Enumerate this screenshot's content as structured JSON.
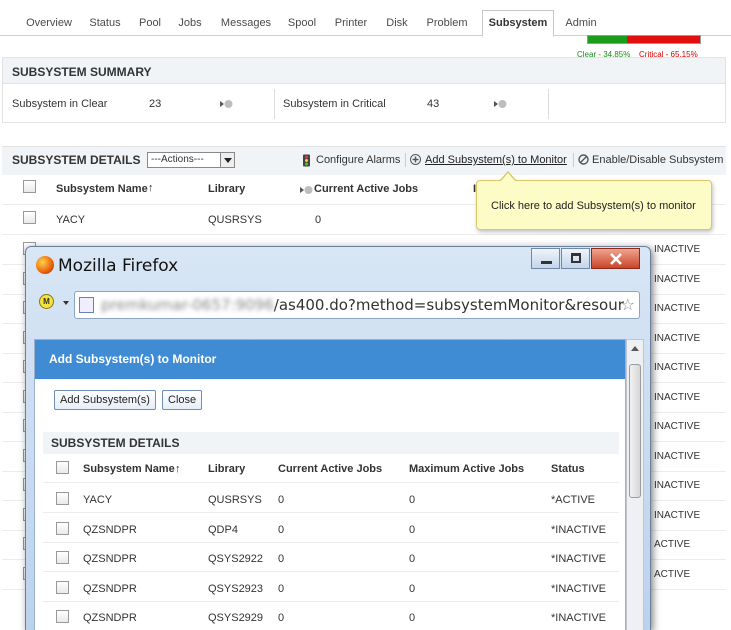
{
  "tabs": [
    "Overview",
    "Status",
    "Pool",
    "Jobs",
    "Messages",
    "Spool",
    "Printer",
    "Disk",
    "Problem",
    "Subsystem",
    "Admin"
  ],
  "active_tab": "Subsystem",
  "summary": {
    "title": "SUBSYSTEM SUMMARY",
    "clear_label": "Subsystem in Clear",
    "clear_value": "23",
    "critical_label": "Subsystem in Critical",
    "critical_value": "43",
    "clear_pct_label": "Clear - 34.85%",
    "critical_pct_label": "Critical - 65.15%",
    "clear_fraction": 0.3485,
    "colors": {
      "clear": "#1c9b1c",
      "critical": "#e20f0f"
    }
  },
  "details": {
    "title": "SUBSYSTEM DETAILS",
    "actions_label": "---Actions---",
    "configure_alarms": "Configure Alarms",
    "add_monitor": "Add Subsystem(s) to Monitor",
    "enable_disable": "Enable/Disable Subsystem",
    "columns": [
      "Subsystem Name",
      "Library",
      "Current Active Jobs",
      "I"
    ],
    "sort_marker": "↑",
    "first_row": {
      "name": "YACY",
      "library": "QUSRSYS",
      "current": "0"
    },
    "right_status": [
      "INACTIVE",
      "INACTIVE",
      "INACTIVE",
      "INACTIVE",
      "INACTIVE",
      "INACTIVE",
      "INACTIVE",
      "INACTIVE",
      "INACTIVE",
      "INACTIVE",
      "ACTIVE",
      "ACTIVE"
    ]
  },
  "tooltip": "Click here to add Subsystem(s) to monitor",
  "popup": {
    "window_title": "Mozilla Firefox",
    "url_blurred": "premkumar-0657:9096",
    "url_visible": "/as400.do?method=subsystemMonitor&resour",
    "dialog_title": "Add Subsystem(s) to Monitor",
    "add_button": "Add Subsystem(s)",
    "close_button": "Close",
    "inner_title": "SUBSYSTEM DETAILS",
    "columns": [
      "Subsystem Name",
      "Library",
      "Current Active Jobs",
      "Maximum Active Jobs",
      "Status"
    ],
    "sort_marker": "↑",
    "rows": [
      [
        "YACY",
        "QUSRSYS",
        "0",
        "0",
        "*ACTIVE"
      ],
      [
        "QZSNDPR",
        "QDP4",
        "0",
        "0",
        "*INACTIVE"
      ],
      [
        "QZSNDPR",
        "QSYS2922",
        "0",
        "0",
        "*INACTIVE"
      ],
      [
        "QZSNDPR",
        "QSYS2923",
        "0",
        "0",
        "*INACTIVE"
      ],
      [
        "QZSNDPR",
        "QSYS2929",
        "0",
        "0",
        "*INACTIVE"
      ]
    ]
  }
}
